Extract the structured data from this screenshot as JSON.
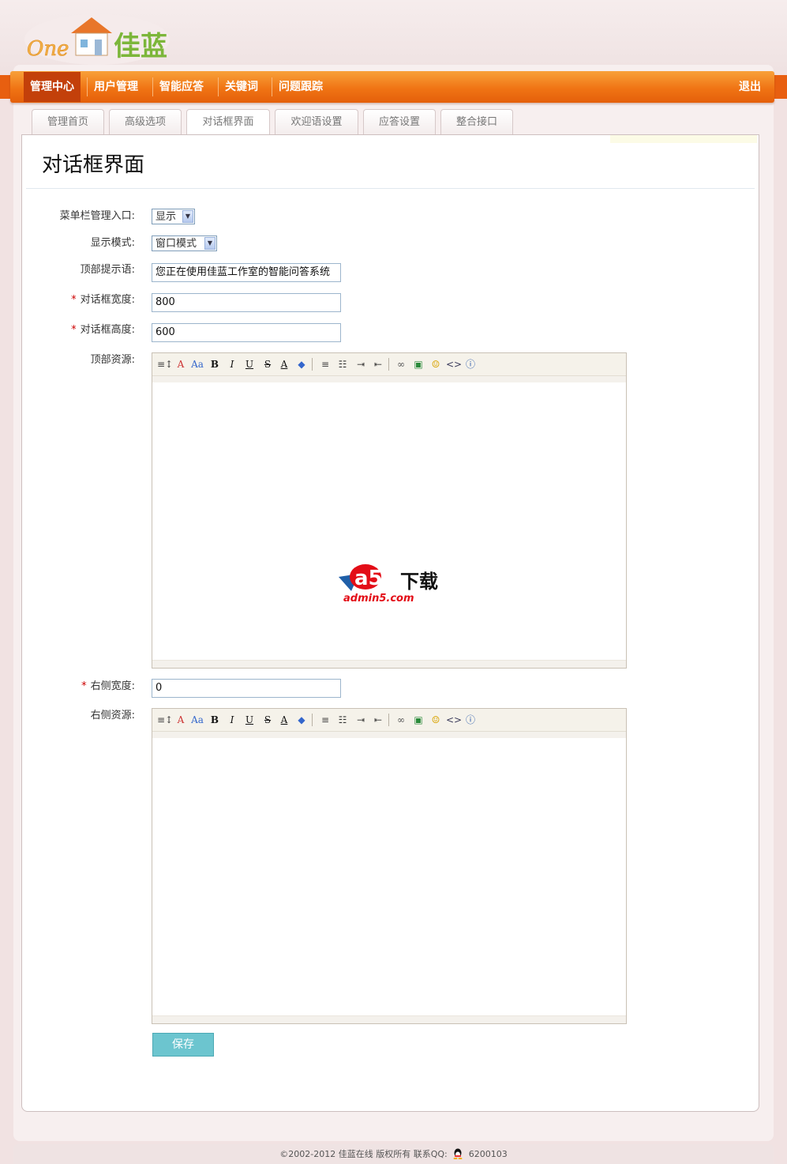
{
  "brand": {
    "logo_text": "One",
    "logo_cn": "佳蓝"
  },
  "nav": {
    "items": [
      {
        "label": "管理中心",
        "active": true
      },
      {
        "label": "用户管理",
        "active": false
      },
      {
        "label": "智能应答",
        "active": false
      },
      {
        "label": "关键词",
        "active": false
      },
      {
        "label": "问题跟踪",
        "active": false
      }
    ],
    "logout": "退出"
  },
  "tabs": [
    {
      "label": "管理首页"
    },
    {
      "label": "高级选项"
    },
    {
      "label": "对话框界面",
      "active": true
    },
    {
      "label": "欢迎语设置"
    },
    {
      "label": "应答设置"
    },
    {
      "label": "整合接口"
    }
  ],
  "page": {
    "title": "对话框界面"
  },
  "form": {
    "menu_entry": {
      "label": "菜单栏管理入口:",
      "value": "显示"
    },
    "display_mode": {
      "label": "显示模式:",
      "value": "窗口模式"
    },
    "top_tip": {
      "label": "顶部提示语:",
      "value": "您正在使用佳蓝工作室的智能问答系统"
    },
    "width": {
      "label": "对话框宽度:",
      "value": "800",
      "required": "*"
    },
    "height": {
      "label": "对话框高度:",
      "value": "600",
      "required": "*"
    },
    "top_resource": {
      "label": "顶部资源:"
    },
    "right_width": {
      "label": "右侧宽度:",
      "value": "0",
      "required": "*"
    },
    "right_resource": {
      "label": "右侧资源:"
    },
    "save": "保存"
  },
  "toolbar_icons": [
    "font-size-icon",
    "font-family-icon",
    "font-style-icon",
    "bold-icon",
    "italic-icon",
    "underline-icon",
    "strikethrough-icon",
    "font-color-icon",
    "highlight-icon",
    "align-icon",
    "list-icon",
    "indent-icon",
    "outdent-icon",
    "link-icon",
    "image-icon",
    "emoticon-icon",
    "source-icon",
    "about-icon"
  ],
  "toolbar_glyphs": {
    "bold": "B",
    "italic": "I",
    "underline": "U",
    "strike": "S",
    "color": "A"
  },
  "watermark": {
    "brand": "a5",
    "cn": "下载",
    "url": "admin5.com"
  },
  "footer": {
    "copyright": "©2002-2012 佳蓝在线 版权所有 联系QQ:",
    "qq": "6200103"
  },
  "colors": {
    "nav_orange": "#f07414",
    "nav_active": "#c3400a",
    "save_button": "#6cc5cf",
    "required": "#cc0000"
  }
}
